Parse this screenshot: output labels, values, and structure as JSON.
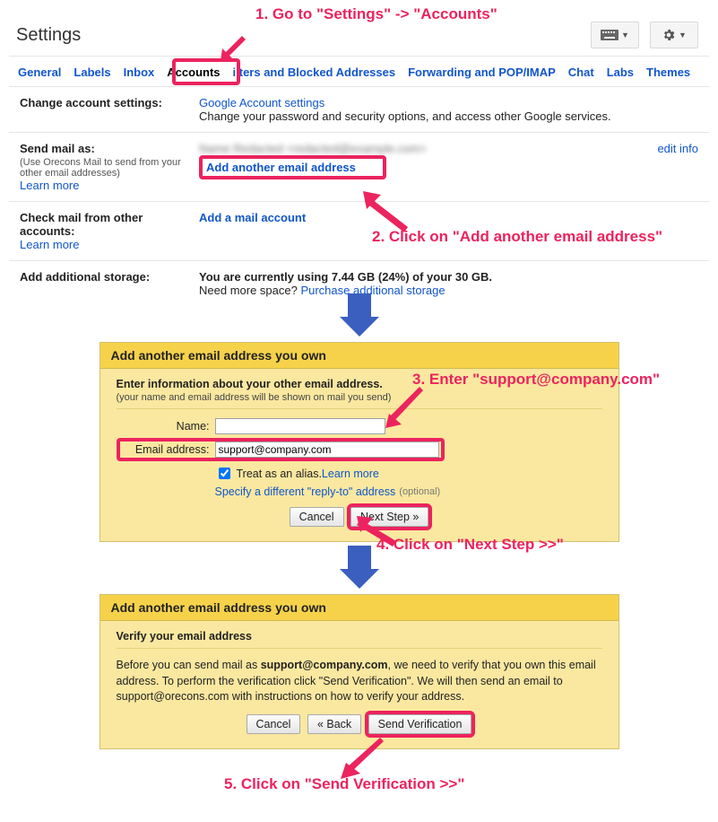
{
  "annotations": {
    "step1": "1. Go to \"Settings\" -> \"Accounts\"",
    "step2": "2. Click on \"Add another email address\"",
    "step3": "3. Enter \"support@company.com\"",
    "step4": "4. Click on \"Next Step >>\"",
    "step5": "5. Click on \"Send Verification >>\""
  },
  "header": {
    "title": "Settings"
  },
  "tabs": {
    "general": "General",
    "labels": "Labels",
    "inbox": "Inbox",
    "accounts": "Accounts",
    "filters": "ilters and Blocked Addresses",
    "forwarding": "Forwarding and POP/IMAP",
    "chat": "Chat",
    "labs": "Labs",
    "themes": "Themes"
  },
  "account_settings": {
    "label": "Change account settings:",
    "link": "Google Account settings",
    "desc": "Change your password and security options, and access other Google services."
  },
  "send_as": {
    "label": "Send mail as:",
    "sub": "(Use Orecons Mail to send from your other email addresses)",
    "learn_more": "Learn more",
    "identity": "Name Redacted <redacted@example.com>",
    "add_another": "Add another email address",
    "edit_info": "edit info"
  },
  "check_mail": {
    "label": "Check mail from other accounts:",
    "learn_more": "Learn more",
    "add_account": "Add a mail account"
  },
  "storage": {
    "label": "Add additional storage:",
    "line_prefix": "You are currently using ",
    "used": "7.44 GB (24%)",
    "of": " of your ",
    "total": "30 GB",
    "suffix": ".",
    "more": "Need more space? ",
    "purchase": "Purchase additional storage"
  },
  "dialog1": {
    "title": "Add another email address you own",
    "heading": "Enter information about your other email address.",
    "sub": "(your name and email address will be shown on mail you send)",
    "name_label": "Name:",
    "name_value": "",
    "email_label": "Email address:",
    "email_value": "support@company.com",
    "alias": "Treat as an alias. ",
    "alias_learn": "Learn more",
    "reply_to": "Specify a different \"reply-to\" address",
    "optional": "(optional)",
    "cancel": "Cancel",
    "next": "Next Step »"
  },
  "dialog2": {
    "title": "Add another email address you own",
    "heading": "Verify your email address",
    "text_a": "Before you can send mail as ",
    "text_email": "support@company.com",
    "text_b": ", we need to verify that you own this email address. To perform the verification click \"Send Verification\". We will then send an email to support@orecons.com with instructions on how to verify your address.",
    "cancel": "Cancel",
    "back": "« Back",
    "send": "Send Verification"
  }
}
